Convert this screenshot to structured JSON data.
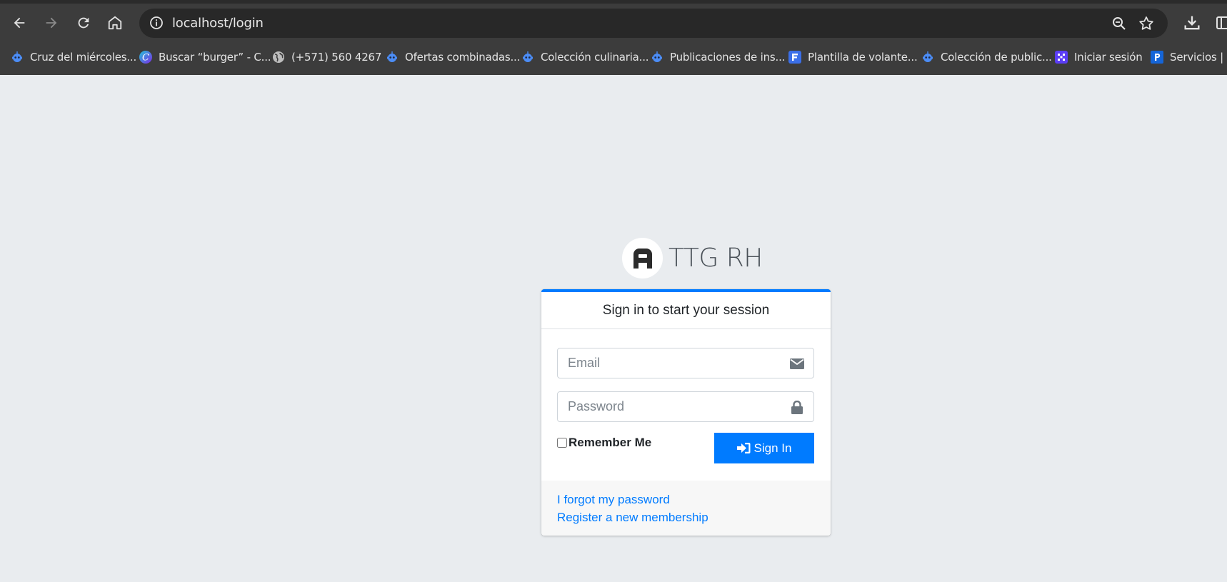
{
  "browser": {
    "url": "localhost/login",
    "bookmarks": [
      {
        "label": "Cruz del miércoles...",
        "icon": "robot-bookmark-icon"
      },
      {
        "label": "Buscar “burger” - C...",
        "icon": "canva-icon"
      },
      {
        "label": "(+571) 560 4267",
        "icon": "globe-icon"
      },
      {
        "label": "Ofertas combinadas...",
        "icon": "robot-bookmark-icon"
      },
      {
        "label": "Colección culinaria...",
        "icon": "robot-bookmark-icon"
      },
      {
        "label": "Publicaciones de ins...",
        "icon": "robot-bookmark-icon"
      },
      {
        "label": "Plantilla de volante...",
        "icon": "flyer-icon"
      },
      {
        "label": "Colección de public...",
        "icon": "robot-bookmark-icon"
      },
      {
        "label": "Iniciar sesión",
        "icon": "login-app-icon"
      },
      {
        "label": "Servicios | C",
        "icon": "services-icon"
      }
    ]
  },
  "brand": {
    "name": "TTG RH",
    "logo_icon": "letter-a-logo-icon"
  },
  "login": {
    "header": "Sign in to start your session",
    "email_placeholder": "Email",
    "password_placeholder": "Password",
    "remember_label": "Remember Me",
    "signin_label": "Sign In",
    "forgot_link": "I forgot my password",
    "register_link": "Register a new membership"
  },
  "colors": {
    "primary": "#007bff",
    "page_bg": "#e9ecef",
    "chrome_bg": "#3c3c3c"
  }
}
